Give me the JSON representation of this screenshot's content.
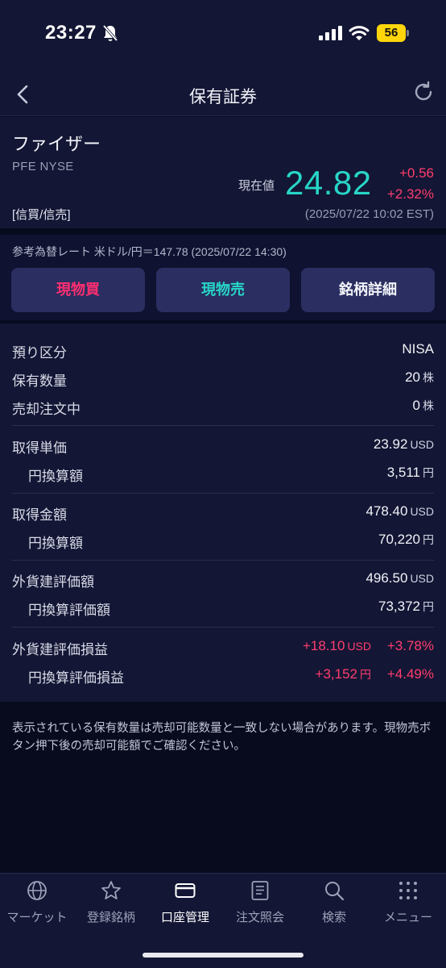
{
  "status_bar": {
    "time": "23:27",
    "battery": "56"
  },
  "header": {
    "title": "保有証券"
  },
  "stock": {
    "name": "ファイザー",
    "code": "PFE NYSE",
    "tag": "[信買/信売]",
    "price_label": "現在値",
    "price": "24.82",
    "change": "+0.56",
    "change_pct": "+2.32%",
    "price_time": "(2025/07/22 10:02 EST)"
  },
  "fx_rate": "参考為替レート 米ドル/円＝147.78 (2025/07/22 14:30)",
  "actions": {
    "buy": "現物買",
    "sell": "現物売",
    "detail": "銘柄詳細"
  },
  "holdings": {
    "account_type": {
      "label": "預り区分",
      "value": "NISA"
    },
    "quantity": {
      "label": "保有数量",
      "value": "20",
      "unit": "株"
    },
    "selling_order": {
      "label": "売却注文中",
      "value": "0",
      "unit": "株"
    },
    "unit_cost": {
      "label": "取得単価",
      "value": "23.92",
      "unit": "USD"
    },
    "unit_cost_jpy": {
      "label": "円換算額",
      "value": "3,511",
      "unit": "円"
    },
    "cost_total": {
      "label": "取得金額",
      "value": "478.40",
      "unit": "USD"
    },
    "cost_total_jpy": {
      "label": "円換算額",
      "value": "70,220",
      "unit": "円"
    },
    "valuation": {
      "label": "外貨建評価額",
      "value": "496.50",
      "unit": "USD"
    },
    "valuation_jpy": {
      "label": "円換算評価額",
      "value": "73,372",
      "unit": "円"
    },
    "pl": {
      "label": "外貨建評価損益",
      "value": "+18.10",
      "unit": "USD",
      "pct": "+3.78%"
    },
    "pl_jpy": {
      "label": "円換算評価損益",
      "value": "+3,152",
      "unit": "円",
      "pct": "+4.49%"
    }
  },
  "note": "表示されている保有数量は売却可能数量と一致しない場合があります。現物売ボタン押下後の売却可能額でご確認ください。",
  "tabs": [
    {
      "label": "マーケット",
      "icon": "globe-icon"
    },
    {
      "label": "登録銘柄",
      "icon": "star-icon"
    },
    {
      "label": "口座管理",
      "icon": "card-icon"
    },
    {
      "label": "注文照会",
      "icon": "document-icon"
    },
    {
      "label": "検索",
      "icon": "search-icon"
    },
    {
      "label": "メニュー",
      "icon": "grid-icon"
    }
  ],
  "colors": {
    "up": "#ff3d6f",
    "price": "#27d6c7",
    "panel": "#131634",
    "background": "#080a1e"
  }
}
